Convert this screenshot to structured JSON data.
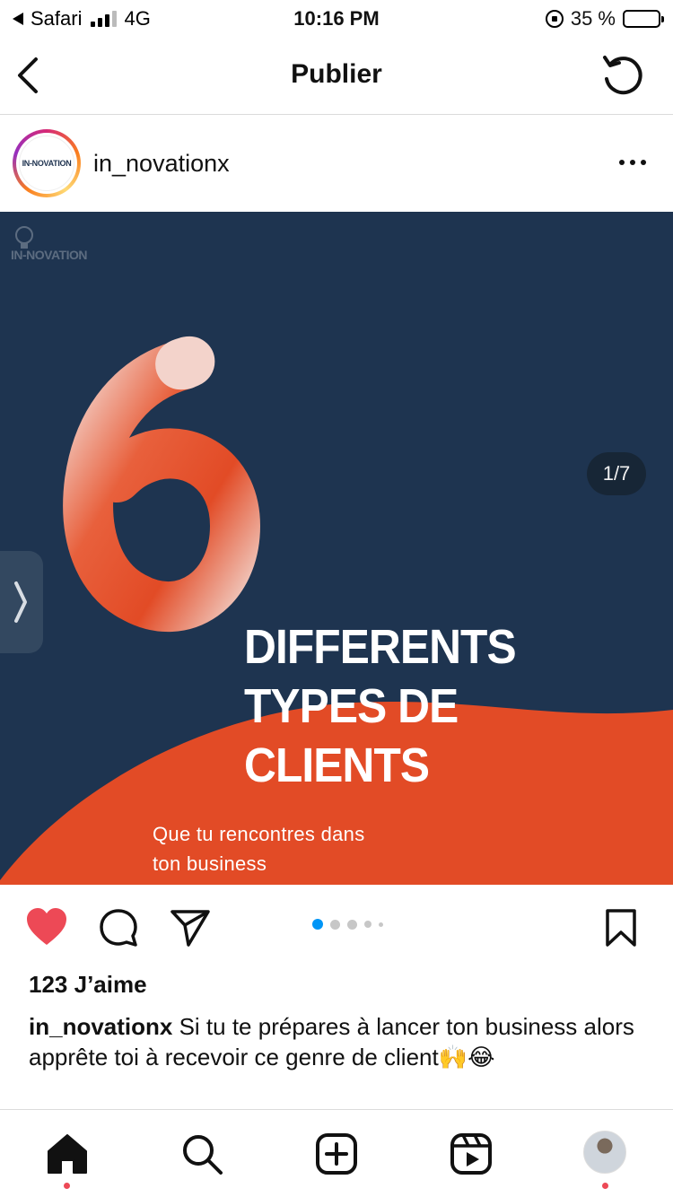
{
  "status_bar": {
    "back_app": "Safari",
    "network": "4G",
    "time": "10:16 PM",
    "battery": "35 %",
    "battery_level": 0.35
  },
  "header": {
    "title": "Publier",
    "back_icon": "chevron-left-icon",
    "refresh_icon": "refresh-icon"
  },
  "post": {
    "username": "in_novationx",
    "avatar_text": "IN-NOVATION",
    "more_icon": "more-horizontal-icon",
    "image": {
      "brand_text": "IN-NOVATION",
      "counter": "1/7",
      "headline": [
        "DIFFERENTS",
        "TYPES DE",
        "CLIENTS"
      ],
      "subline": [
        "Que tu rencontres dans",
        "ton business"
      ],
      "colors": {
        "background": "#1e3450",
        "accent": "#e24b26"
      }
    },
    "carousel": {
      "total": 7,
      "current": 1
    },
    "likes": "123 J’aime",
    "caption_user": "in_novationx",
    "caption_text": " Si tu te prépares à lancer ton business alors apprête toi à recevoir ce genre de client🙌😂"
  },
  "actions": {
    "like_icon": "heart-filled-icon",
    "comment_icon": "comment-icon",
    "share_icon": "send-icon",
    "save_icon": "bookmark-icon",
    "like_color": "#ed4956"
  },
  "bottom_nav": {
    "items": [
      "home-icon",
      "search-icon",
      "create-icon",
      "reels-icon",
      "profile-avatar"
    ]
  }
}
